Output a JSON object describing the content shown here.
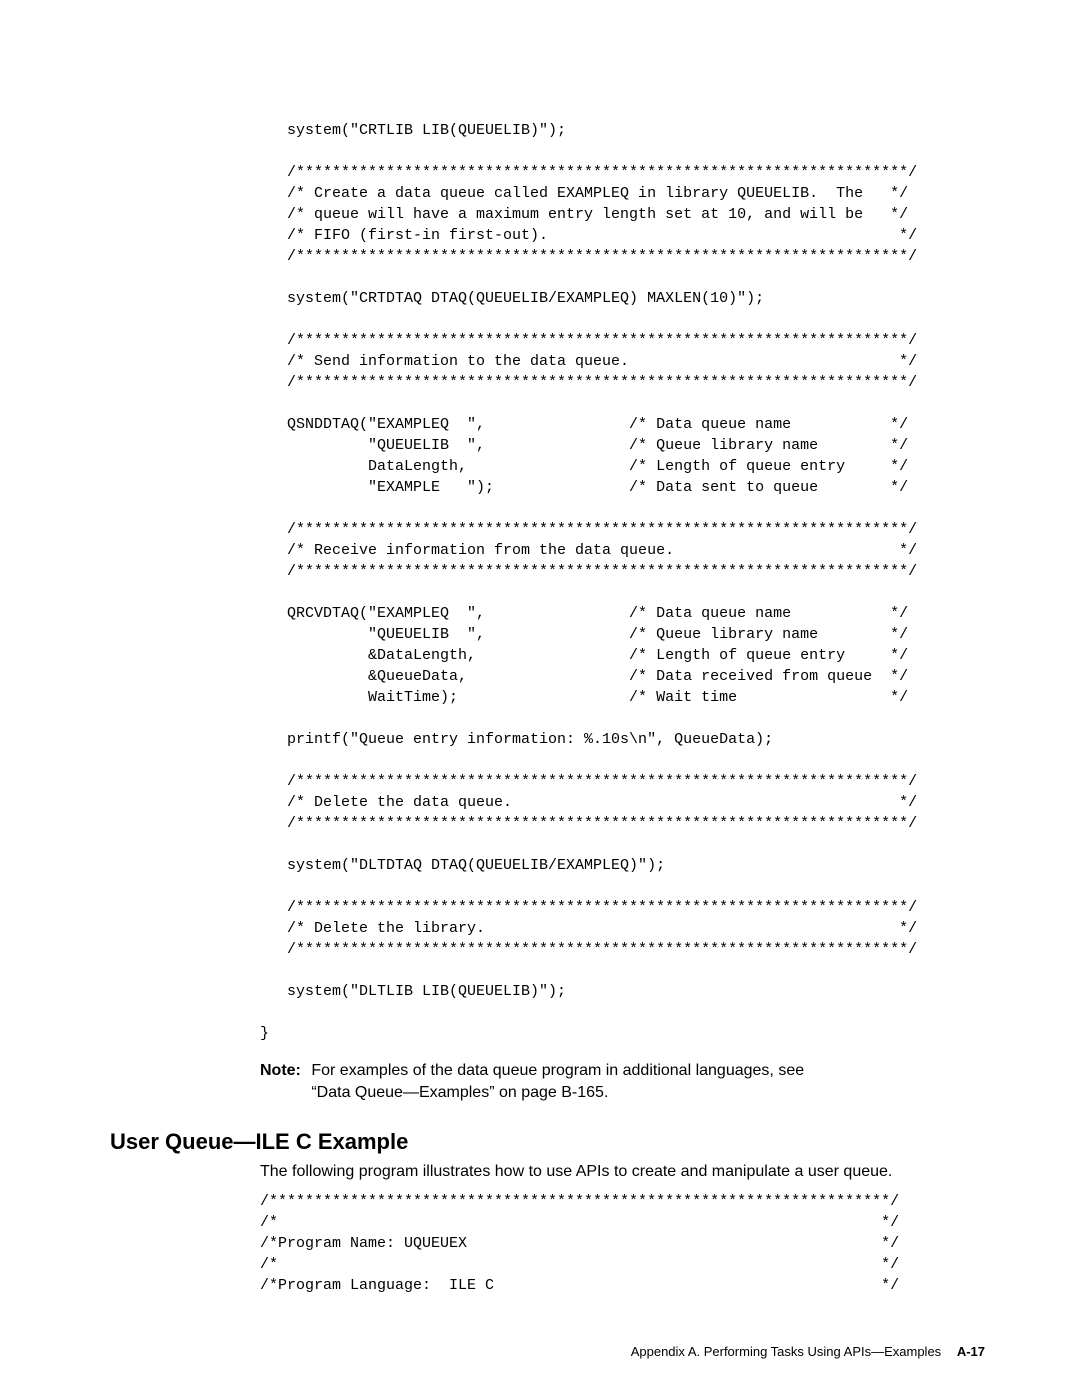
{
  "code1": "   system(\"CRTLIB LIB(QUEUELIB)\");\n\n   /********************************************************************/\n   /* Create a data queue called EXAMPLEQ in library QUEUELIB.  The   */\n   /* queue will have a maximum entry length set at 10, and will be   */\n   /* FIFO (first-in first-out).                                       */\n   /********************************************************************/\n\n   system(\"CRTDTAQ DTAQ(QUEUELIB/EXAMPLEQ) MAXLEN(10)\");\n\n   /********************************************************************/\n   /* Send information to the data queue.                              */\n   /********************************************************************/\n\n   QSNDDTAQ(\"EXAMPLEQ  \",                /* Data queue name           */\n            \"QUEUELIB  \",                /* Queue library name        */\n            DataLength,                  /* Length of queue entry     */\n            \"EXAMPLE   \");               /* Data sent to queue        */\n\n   /********************************************************************/\n   /* Receive information from the data queue.                         */\n   /********************************************************************/\n\n   QRCVDTAQ(\"EXAMPLEQ  \",                /* Data queue name           */\n            \"QUEUELIB  \",                /* Queue library name        */\n            &DataLength,                 /* Length of queue entry     */\n            &QueueData,                  /* Data received from queue  */\n            WaitTime);                   /* Wait time                 */\n\n   printf(\"Queue entry information: %.10s\\n\", QueueData);\n\n   /********************************************************************/\n   /* Delete the data queue.                                           */\n   /********************************************************************/\n\n   system(\"DLTDTAQ DTAQ(QUEUELIB/EXAMPLEQ)\");\n\n   /********************************************************************/\n   /* Delete the library.                                              */\n   /********************************************************************/\n\n   system(\"DLTLIB LIB(QUEUELIB)\");\n\n}",
  "note": {
    "label": "Note:",
    "text": "For examples of the data queue program in additional languages, see “Data Queue—Examples” on page B-165."
  },
  "section_heading": "User Queue—ILE C Example",
  "section_intro": "The following program illustrates how to use APIs to create and manipulate a user queue.",
  "code2": "/*********************************************************************/\n/*                                                                   */\n/*Program Name: UQUEUEX                                              */\n/*                                                                   */\n/*Program Language:  ILE C                                           */",
  "footer": {
    "text": "Appendix A.  Performing Tasks Using APIs—Examples",
    "page": "A-17"
  }
}
